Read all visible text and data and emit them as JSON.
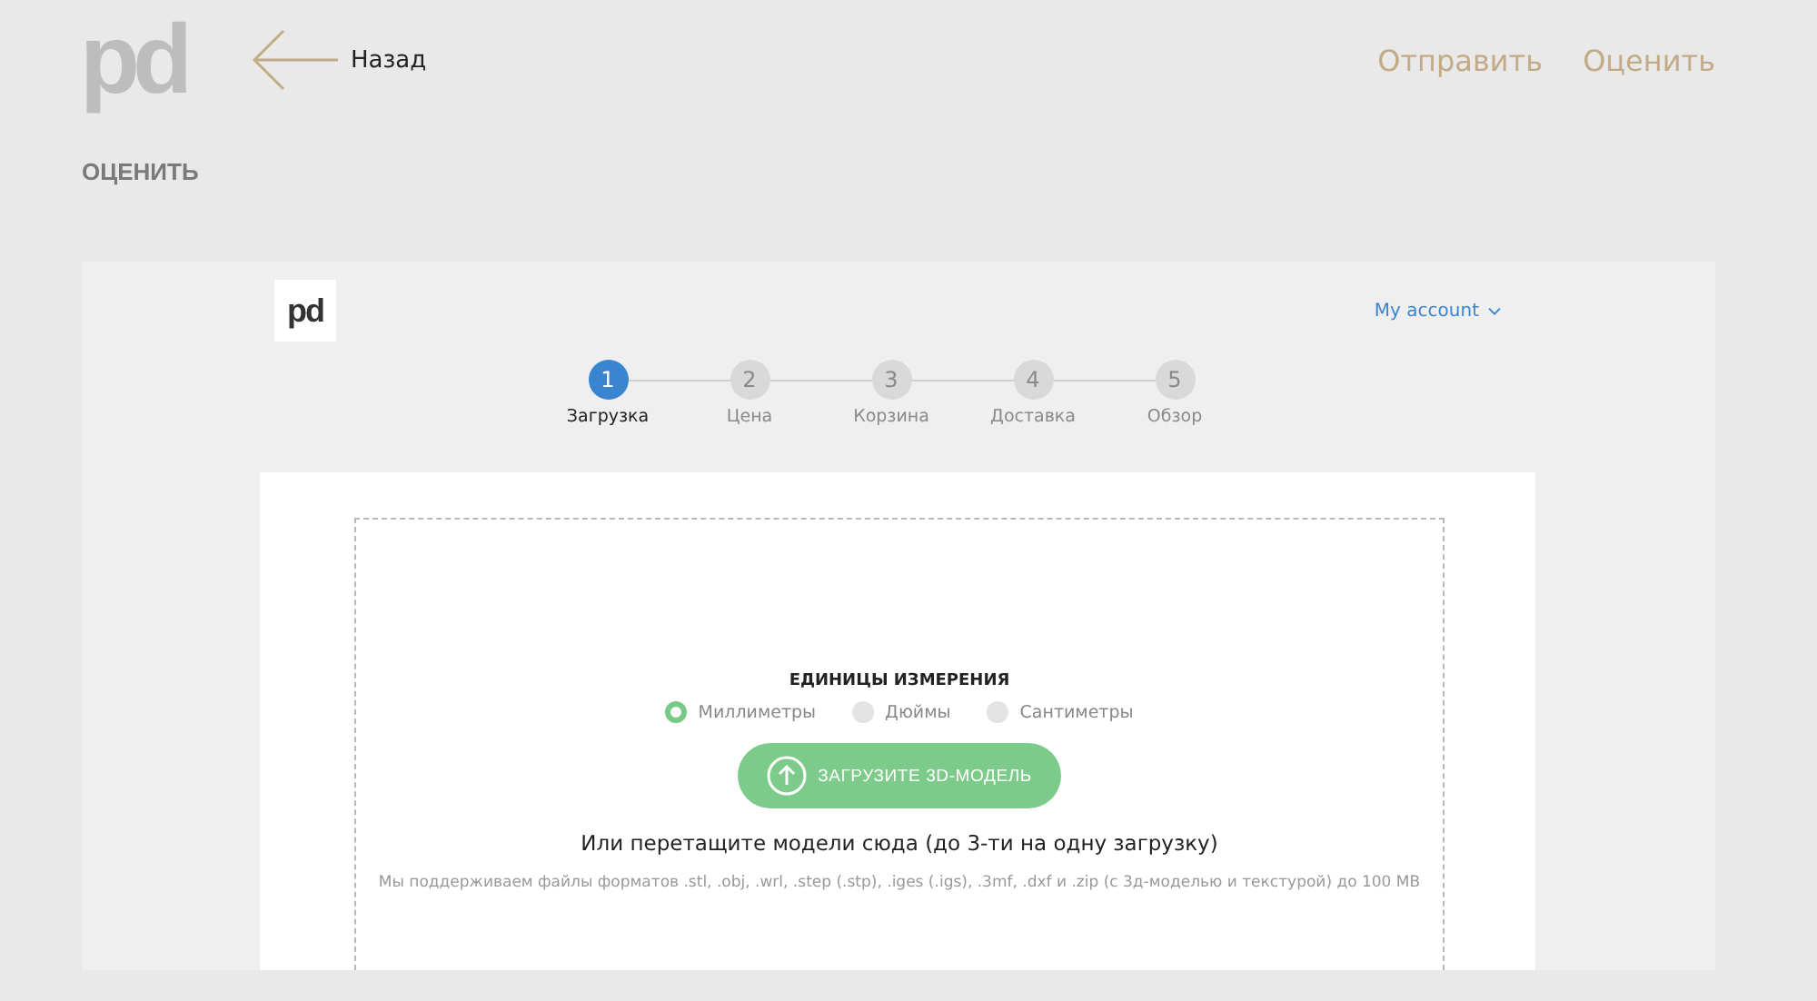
{
  "header": {
    "logo": "pd",
    "back": "Назад",
    "nav": [
      {
        "label": "Отправить"
      },
      {
        "label": "Оценить"
      }
    ]
  },
  "page_title": "ОЦЕНИТЬ",
  "embed": {
    "logo": "pd",
    "account": "My account",
    "steps": [
      {
        "number": "1",
        "label": "Загрузка",
        "selected": true
      },
      {
        "number": "2",
        "label": "Цена",
        "selected": false
      },
      {
        "number": "3",
        "label": "Корзина",
        "selected": false
      },
      {
        "number": "4",
        "label": "Доставка",
        "selected": false
      },
      {
        "number": "5",
        "label": "Обзор",
        "selected": false
      }
    ],
    "units_title": "ЕДИНИЦЫ ИЗМЕРЕНИЯ",
    "units": [
      {
        "label": "Миллиметры",
        "selected": true
      },
      {
        "label": "Дюймы",
        "selected": false
      },
      {
        "label": "Сантиметры",
        "selected": false
      }
    ],
    "upload_button": "ЗАГРУЗИТЕ 3D-МОДЕЛЬ",
    "drop_hint": "Или перетащите модели сюда (до 3-ти на одну загрузку)",
    "formats_note": "Мы поддерживаем файлы форматов .stl, .obj, .wrl, .step (.stp), .iges (.igs), .3mf, .dxf и .zip (с 3д-моделью и текстурой) до 100 MB"
  }
}
